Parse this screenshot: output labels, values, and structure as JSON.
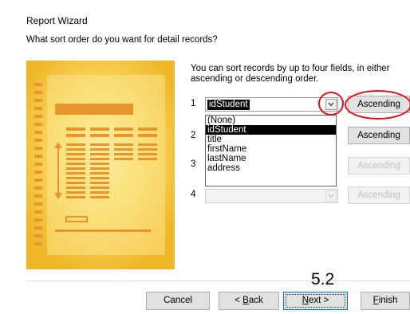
{
  "window": {
    "title": "Report Wizard"
  },
  "prompt": "What sort order do you want for detail records?",
  "instructions": "You can sort records by up to four fields, in either ascending or descending order.",
  "sort_rows": [
    {
      "number": "1",
      "field": "idStudent",
      "order": "Ascending",
      "enabled": true
    },
    {
      "number": "2",
      "field": "",
      "order": "Ascending",
      "enabled": true
    },
    {
      "number": "3",
      "field": "",
      "order": "Ascending",
      "enabled": false
    },
    {
      "number": "4",
      "field": "",
      "order": "Ascending",
      "enabled": false
    }
  ],
  "dropdown": {
    "options": [
      "(None)",
      "idStudent",
      "title",
      "firstName",
      "lastName",
      "address"
    ],
    "highlighted": "idStudent"
  },
  "annotation": "5.2",
  "buttons": {
    "cancel": "Cancel",
    "back_prefix": "< ",
    "back_key": "B",
    "back_rest": "ack",
    "next_key": "N",
    "next_rest": "ext >",
    "finish_key": "F",
    "finish_rest": "inish"
  },
  "colors": {
    "annotation_ring": "#e0101a",
    "illustration": "#f4c342",
    "selection": "#000000"
  },
  "icons": [
    "chevron-down-icon",
    "report-preview-illustration"
  ]
}
